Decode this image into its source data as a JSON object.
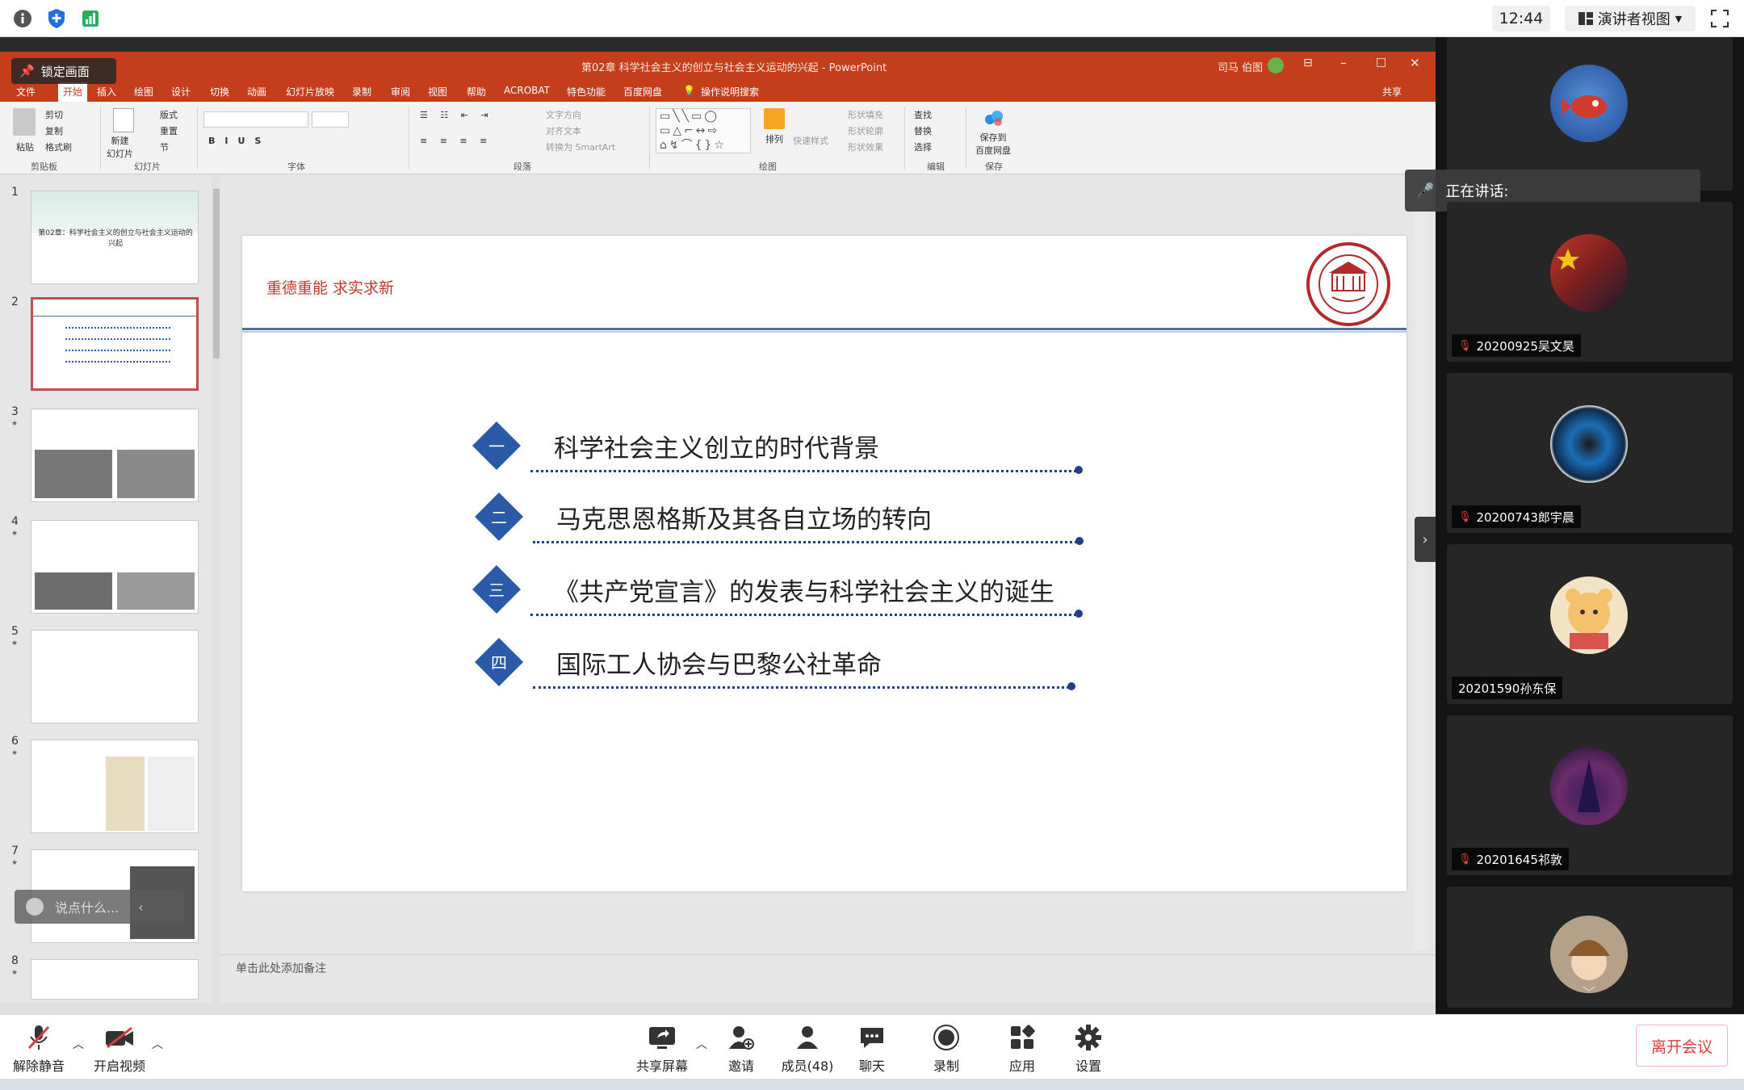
{
  "topbar": {
    "time": "12:44",
    "view_label": "演讲者视图"
  },
  "lock_overlay": {
    "label": "锁定画面"
  },
  "powerpoint": {
    "window_title": "第02章 科学社会主义的创立与社会主义运动的兴起 - PowerPoint",
    "user": "司马 伯图",
    "menu": [
      "文件",
      "开始",
      "插入",
      "绘图",
      "设计",
      "切换",
      "动画",
      "幻灯片放映",
      "录制",
      "审阅",
      "视图",
      "帮助",
      "ACROBAT",
      "特色功能",
      "百度网盘"
    ],
    "search_hint": "操作说明搜索",
    "share_label": "共享",
    "ribbon_groups": [
      "剪贴板",
      "幻灯片",
      "字体",
      "段落",
      "绘图",
      "编辑",
      "保存"
    ],
    "ribbon": {
      "paste": "粘贴",
      "cut": "剪切",
      "copy": "复制",
      "format_painter": "格式刷",
      "new_slide": "新建\n幻灯片",
      "layout": "版式",
      "reset": "重置",
      "section": "节",
      "text_direction": "文字方向",
      "align_text": "对齐文本",
      "smartart": "转换为 SmartArt",
      "arrange": "排列",
      "quick_styles": "快速样式",
      "shape_fill": "形状填充",
      "shape_outline": "形状轮廓",
      "shape_effects": "形状效果",
      "find": "查找",
      "replace": "替换",
      "select": "选择",
      "save_to_baidu": "保存到\n百度网盘"
    },
    "thumbnails": [
      "1",
      "2",
      "3",
      "4",
      "5",
      "6",
      "7",
      "8"
    ],
    "thumb1_title": "第02章：科学社会主义的创立与社会主义运动的兴起",
    "notes_placeholder": "单击此处添加备注"
  },
  "slide": {
    "slogan": "重德重能 求实求新",
    "items": [
      {
        "num": "一",
        "text": "科学社会主义创立的时代背景"
      },
      {
        "num": "二",
        "text": "马克思恩格斯及其各自立场的转向"
      },
      {
        "num": "三",
        "text": "《共产党宣言》的发表与科学社会主义的诞生"
      },
      {
        "num": "四",
        "text": "国际工人协会与巴黎公社革命"
      }
    ],
    "colors": {
      "diamond": "#2b5aa8",
      "slogan": "#c0392b",
      "dots": "#1f3f8a"
    }
  },
  "say_overlay": {
    "placeholder": "说点什么..."
  },
  "panel": {
    "speaking_label": "正在讲话:",
    "participants": [
      {
        "name": "20200925吴文昊",
        "muted": true
      },
      {
        "name": "20200743郎宇晨",
        "muted": true
      },
      {
        "name": "20201590孙东保",
        "muted": false
      },
      {
        "name": "20201645祁敦",
        "muted": true
      }
    ]
  },
  "toolbar": {
    "unmute": "解除静音",
    "start_video": "开启视频",
    "share_screen": "共享屏幕",
    "invite": "邀请",
    "members": "成员(48)",
    "chat": "聊天",
    "record": "录制",
    "apps": "应用",
    "settings": "设置",
    "leave": "离开会议"
  }
}
